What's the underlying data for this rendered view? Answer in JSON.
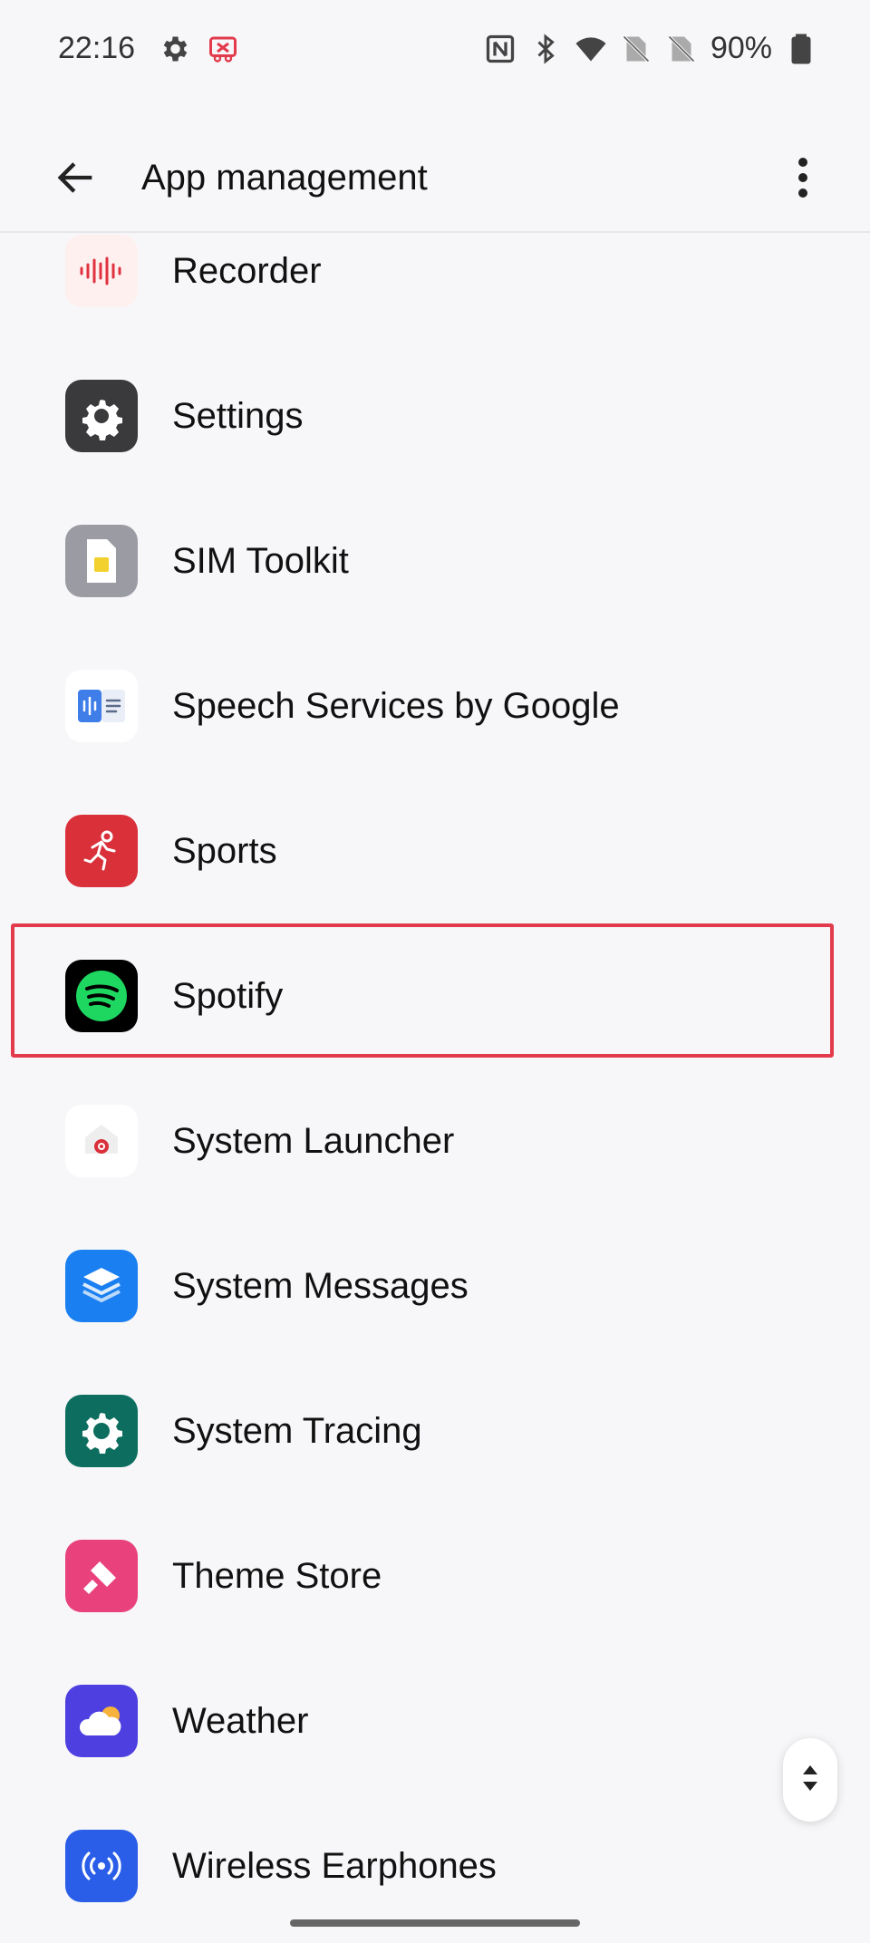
{
  "status_bar": {
    "time": "22:16",
    "battery_percent": "90%",
    "left_icons": [
      "gear-icon",
      "screen-record-icon"
    ],
    "right_icons": [
      "nfc-icon",
      "bluetooth-icon",
      "wifi-icon",
      "no-sim-icon",
      "no-sim-icon",
      "battery-icon"
    ]
  },
  "app_bar": {
    "title": "App management",
    "back_icon": "arrow-left-icon",
    "more_icon": "more-vertical-icon"
  },
  "apps": [
    {
      "label": "Recorder",
      "icon": "recorder-icon"
    },
    {
      "label": "Settings",
      "icon": "settings-icon"
    },
    {
      "label": "SIM Toolkit",
      "icon": "sim-toolkit-icon"
    },
    {
      "label": "Speech Services by Google",
      "icon": "speech-services-icon"
    },
    {
      "label": "Sports",
      "icon": "sports-icon"
    },
    {
      "label": "Spotify",
      "icon": "spotify-icon",
      "highlighted": true
    },
    {
      "label": "System Launcher",
      "icon": "system-launcher-icon"
    },
    {
      "label": "System Messages",
      "icon": "system-messages-icon"
    },
    {
      "label": "System Tracing",
      "icon": "system-tracing-icon"
    },
    {
      "label": "Theme Store",
      "icon": "theme-store-icon"
    },
    {
      "label": "Weather",
      "icon": "weather-icon"
    },
    {
      "label": "Wireless Earphones",
      "icon": "wireless-earphones-icon"
    }
  ],
  "colors": {
    "highlight": "#e33a4c",
    "background": "#f7f7f9"
  }
}
